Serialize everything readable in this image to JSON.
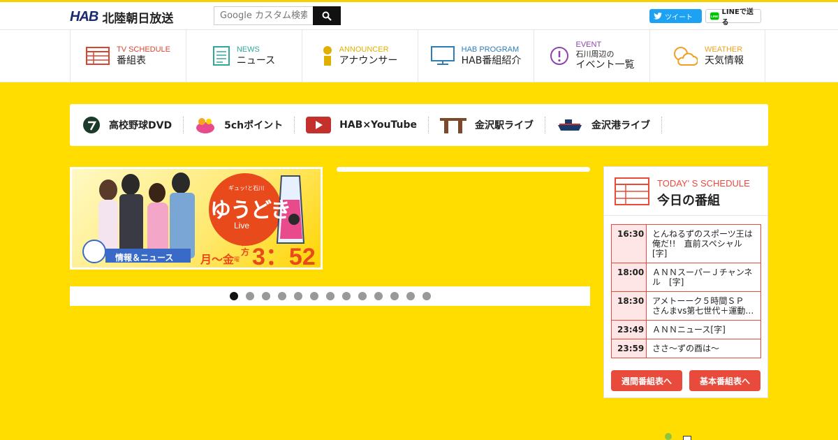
{
  "header": {
    "logo_mark": "HAB",
    "logo_text": "北陸朝日放送",
    "search_placeholder": "Google カスタム検索",
    "tweet_label": "ツイート",
    "line_label": "LINEで送る"
  },
  "nav": [
    {
      "en": "TV SCHEDULE",
      "jp": "番組表",
      "color": "#d9442f"
    },
    {
      "en": "NEWS",
      "jp": "ニュース",
      "color": "#2fa89a"
    },
    {
      "en": "ANNOUNCER",
      "jp": "アナウンサー",
      "color": "#e0b000"
    },
    {
      "en": "HAB PROGRAM",
      "jp": "HAB番組紹介",
      "color": "#2f7db8"
    },
    {
      "en": "EVENT",
      "jp_small": "石川周辺の",
      "jp": "イベント一覧",
      "color": "#8e44ad"
    },
    {
      "en": "WEATHER",
      "jp": "天気情報",
      "color": "#f0a020"
    }
  ],
  "quick_links": [
    {
      "label": "高校野球DVD"
    },
    {
      "label": "5chポイント"
    },
    {
      "label": "HAB×YouTube"
    },
    {
      "label": "金沢駅ライブ"
    },
    {
      "label": "金沢港ライブ"
    }
  ],
  "banner": {
    "tag": "ギュッ!と石川",
    "title": "ゆうどき",
    "sub": "Live",
    "info": "情報＆ニュース",
    "days": "月～金",
    "cho": "曜",
    "evening": "夕方",
    "time": "3：52"
  },
  "carousel": {
    "dot_count": 13,
    "active_index": 0
  },
  "schedule": {
    "en": "TODAY' S SCHEDULE",
    "jp": "今日の番組",
    "rows": [
      {
        "time": "16:30",
        "title": "とんねるずのスポーツ王は俺だ!!　直前スペシャル[字]"
      },
      {
        "time": "18:00",
        "title": "ＡＮＮスーパーＪチャンネル　[字]"
      },
      {
        "time": "18:30",
        "title": "アメトーーク５時間ＳＰ　さんまvs第七世代＋運動…"
      },
      {
        "time": "23:49",
        "title": "ＡＮＮニュース[字]"
      },
      {
        "time": "23:59",
        "title": "ささ～ずの酉は～"
      }
    ],
    "weekly_button": "週間番組表へ",
    "basic_button": "基本番組表へ"
  },
  "colors": {
    "accent_yellow": "#ffdd00",
    "schedule_red": "#e84a3c"
  }
}
